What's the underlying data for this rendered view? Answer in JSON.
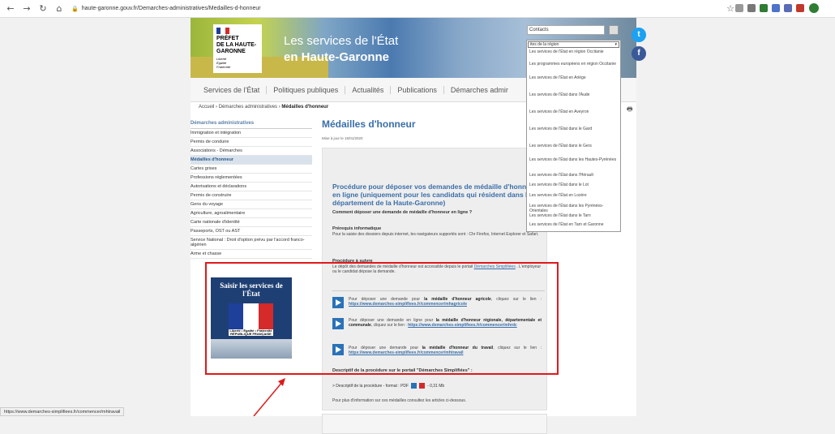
{
  "browser": {
    "url": "haute-garonne.gouv.fr/Demarches-administratives/Medailles-d-honneur"
  },
  "banner": {
    "logo_lines": [
      "PRÉFET",
      "DE LA HAUTE-",
      "GARONNE"
    ],
    "logo_motto": [
      "Liberté",
      "Égalité",
      "Fraternité"
    ],
    "title1": "Les services de l'État",
    "title2": "en Haute-Garonne"
  },
  "nav": [
    "Services de l'État",
    "Politiques publiques",
    "Actualités",
    "Publications",
    "Démarches admir"
  ],
  "breadcrumb": {
    "home": "Accueil",
    "sep": "›",
    "section": "Démarches administratives",
    "current": "Médailles d'honneur"
  },
  "sidebar": {
    "heading": "Démarches administratives",
    "items": [
      "Immigration et intégration",
      "Permis de conduire",
      "Associations - Démarches",
      "Médailles d'honneur",
      "Cartes grises",
      "Professions réglementées",
      "Autorisations et déclarations",
      "Permis de construire",
      "Gens du voyage",
      "Agriculture, agroalimentaire",
      "Carte nationale d'identité",
      "Passeports, OST ou AST",
      "Service National : Droit d'option prévu par l'accord franco-algérien",
      "Arme et chasse"
    ],
    "active_index": 3
  },
  "promo": {
    "title": "Saisir les services de l'État",
    "motto": "Liberté • Égalité • Fraternité",
    "rf": "RÉPUBLIQUE FRANÇAISE"
  },
  "main": {
    "title": "Médailles d'honneur",
    "updated": "Mise à jour le 15/01/2020",
    "box_title": "Procédure pour déposer vos demandes de médaille d'honneur en ligne (uniquement pour les candidats qui résident dans le département de la Haute-Garonne)",
    "question": "Comment déposer une demande de médaille d'honneur en ligne ?",
    "prereq_title": "Prérequis informatique",
    "prereq_text": "Pour la saisie des dossiers depuis internet, les navigateurs supportés sont : Chr Firefox, Internet Explorer et Safari.",
    "proc_title": "Procédure à suivre",
    "proc_text_1": "Le dépôt des demandes de médaille d'honneur est accessible depuis le portail",
    "proc_link": "Démarches Simplifiées",
    "proc_text_2": ". L'employeur ou le candidat dépose la demande.",
    "items": [
      {
        "pre": "Pour déposer une demande pour ",
        "bold": "la médaille d'honneur agricole",
        "post": ", cliquez sur le lien : ",
        "link": "https://www.demarches-simplifiees.fr/commencer/mhagricole"
      },
      {
        "pre": "Pour déposer une demande en ligne pour ",
        "bold": "la médaille d'honneur régionale, départementale et communale",
        "post": ", cliquez sur le lien : ",
        "link": "https://www.demarches-simplifiees.fr/commencer/mhrdc"
      },
      {
        "pre": "Pour déposer une demande pour ",
        "bold": "la médaille d'honneur du travail",
        "post": ", cliquez sur le lien : ",
        "link": "https://www.demarches-simplifiees.fr/commencer/mhtravail"
      }
    ],
    "desc_title": "Descriptif de la procédure sur le portail \"Démarches Simplifiées\" :",
    "desc_line": "> Descriptif de la procédure - format : PDF",
    "desc_size": "- 0,31 Mb",
    "more": "Pour plus d'information sur ces médailles consultez les articles ci-dessous."
  },
  "header_tools": {
    "contacts_placeholder": "Contacts",
    "dropdown_selected": "ites de la région",
    "dropdown_options": [
      "Les services de l'État en région Occitanie",
      "Les programmes européens en région Occitanie",
      "Les services de l'État en Ariège",
      "Les services de l'État dans l'Aude",
      "Les services de l'État en Aveyron",
      "Les services de l'État dans le Gard",
      "Les services de l'État dans le Gers",
      "Les services de l'État dans les Hautes-Pyrénées",
      "Les services de l'État dans l'Hérault",
      "Les services de l'État dans le Lot",
      "Les services de l'État en Lozère",
      "Les services de l'État dans les Pyrénées-Orientales",
      "Les services de l'État dans le Tarn",
      "Les services de l'État en Tarn et Garonne"
    ]
  },
  "status_url": "https://www.demarches-simplifiees.fr/commencer/mhtravail",
  "colors": {
    "accent": "#3a6ea8",
    "highlight_red": "#e0191b",
    "twitter": "#1da1f2",
    "facebook": "#3b5998"
  }
}
